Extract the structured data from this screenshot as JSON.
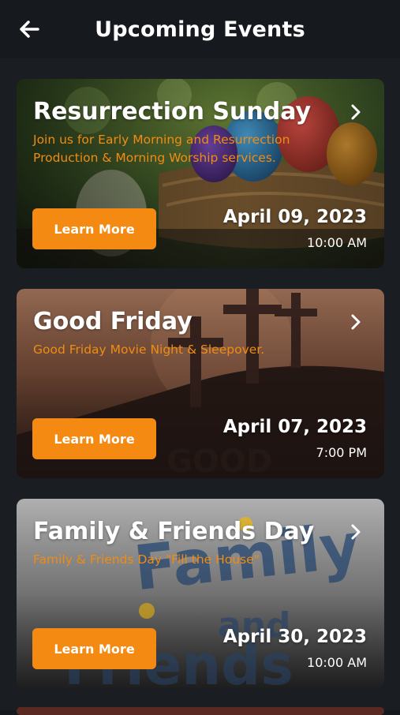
{
  "header": {
    "title": "Upcoming Events",
    "back_icon": "arrow-left-icon"
  },
  "events": [
    {
      "title": "Resurrection Sunday",
      "description": "Join us for Early Morning and Resurrection Production & Morning Worship services.",
      "button": "Learn More",
      "date": "April 09, 2023",
      "time": "10:00 AM"
    },
    {
      "title": "Good Friday",
      "description": "Good Friday Movie Night & Sleepover.",
      "button": "Learn More",
      "date": "April 07, 2023",
      "time": "7:00 PM"
    },
    {
      "title": "Family & Friends Day",
      "description": "Family & Friends Day \"Fill the House\"",
      "button": "Learn More",
      "date": "April 30, 2023",
      "time": "10:00 AM"
    }
  ],
  "colors": {
    "accent": "#f58a12",
    "background": "#1a1d21"
  }
}
